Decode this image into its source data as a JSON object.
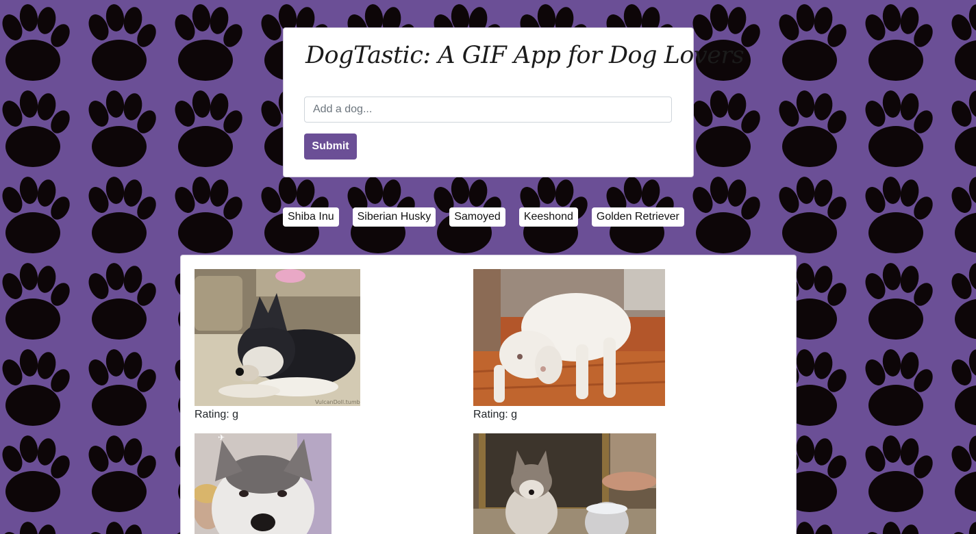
{
  "colors": {
    "background": "#6b4f96",
    "paw": "#0d0608",
    "accent": "#6b4f96"
  },
  "header": {
    "title": "DogTastic: A GIF App for Dog Lovers",
    "search_placeholder": "Add a dog...",
    "submit_label": "Submit"
  },
  "breeds": [
    "Shiba Inu",
    "Siberian Husky",
    "Samoyed",
    "Keeshond",
    "Golden Retriever"
  ],
  "gifs": [
    {
      "subject": "husky puppy lying on carpet",
      "rating_text": "Rating: g",
      "watermark": "VulcanDoll.tumblr"
    },
    {
      "subject": "white puppy chasing tail",
      "rating_text": "Rating: g"
    },
    {
      "subject": "husky face close-up",
      "rating_text": ""
    },
    {
      "subject": "husky puppy sitting by mirror",
      "rating_text": ""
    }
  ]
}
